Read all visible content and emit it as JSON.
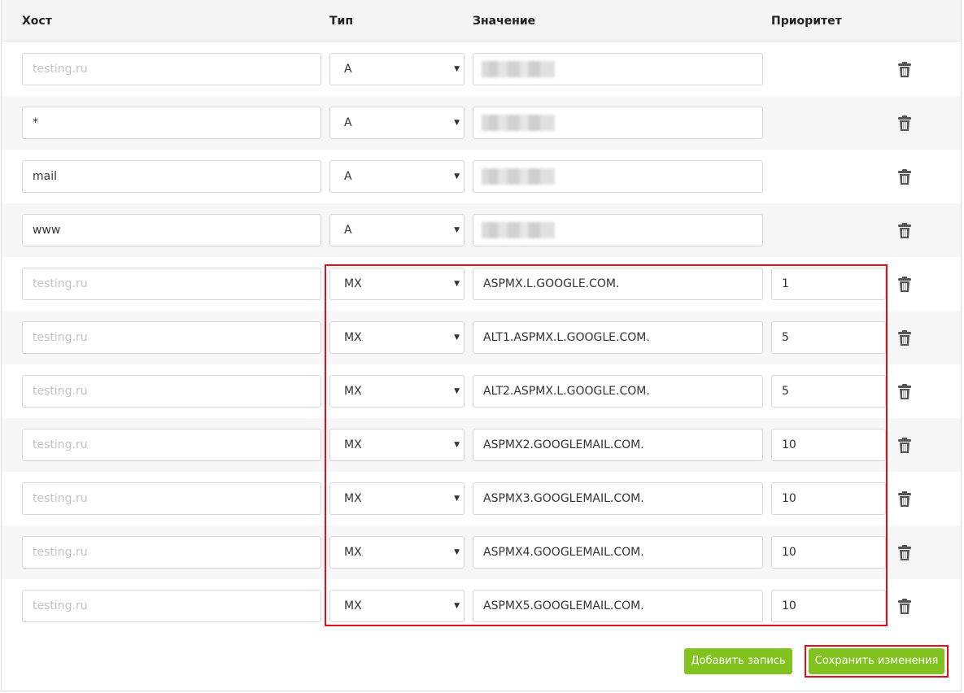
{
  "table": {
    "headers": {
      "host": "Хост",
      "type": "Тип",
      "value": "Значение",
      "priority": "Приоритет"
    },
    "host_placeholder": "testing.ru",
    "rows": [
      {
        "host": "",
        "type": "A",
        "value": "",
        "priority": ""
      },
      {
        "host": "*",
        "type": "A",
        "value": "",
        "priority": ""
      },
      {
        "host": "mail",
        "type": "A",
        "value": "",
        "priority": ""
      },
      {
        "host": "www",
        "type": "A",
        "value": "",
        "priority": ""
      },
      {
        "host": "",
        "type": "MX",
        "value": "ASPMX.L.GOOGLE.COM.",
        "priority": "1"
      },
      {
        "host": "",
        "type": "MX",
        "value": "ALT1.ASPMX.L.GOOGLE.COM.",
        "priority": "5"
      },
      {
        "host": "",
        "type": "MX",
        "value": "ALT2.ASPMX.L.GOOGLE.COM.",
        "priority": "5"
      },
      {
        "host": "",
        "type": "MX",
        "value": "ASPMX2.GOOGLEMAIL.COM.",
        "priority": "10"
      },
      {
        "host": "",
        "type": "MX",
        "value": "ASPMX3.GOOGLEMAIL.COM.",
        "priority": "10"
      },
      {
        "host": "",
        "type": "MX",
        "value": "ASPMX4.GOOGLEMAIL.COM.",
        "priority": "10"
      },
      {
        "host": "",
        "type": "MX",
        "value": "ASPMX5.GOOGLEMAIL.COM.",
        "priority": "10"
      }
    ]
  },
  "actions": {
    "add_label": "Добавить запись",
    "save_label": "Сохранить изменения"
  },
  "icons": {
    "select_arrow": "▼",
    "delete": "trash-icon"
  },
  "colors": {
    "accent_button": "#82c21f",
    "highlight_border": "#e0101b"
  }
}
